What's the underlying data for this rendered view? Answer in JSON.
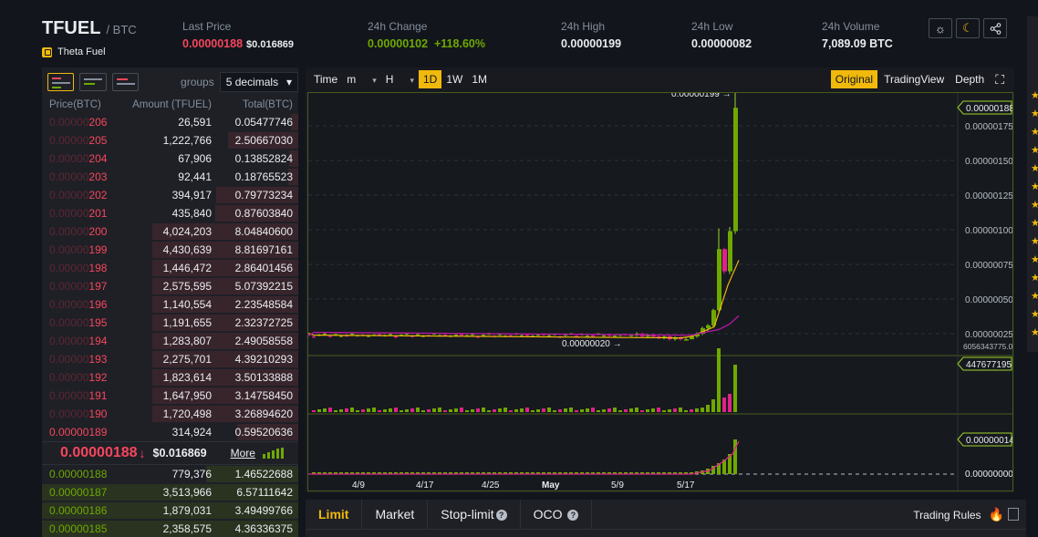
{
  "header": {
    "pair_base": "TFUEL",
    "pair_quote": "/ BTC",
    "coin_name": "Theta Fuel",
    "last_price_label": "Last Price",
    "last_price": "0.00000188",
    "last_price_usd": "$0.016869",
    "change_label": "24h Change",
    "change_value": "0.00000102",
    "change_pct": "+118.60%",
    "high_label": "24h High",
    "high_value": "0.00000199",
    "low_label": "24h Low",
    "low_value": "0.00000082",
    "volume_label": "24h Volume",
    "volume_value": "7,089.09 BTC",
    "icons": [
      "sun-icon",
      "moon-icon",
      "share-icon"
    ]
  },
  "orderbook": {
    "groups_label": "groups",
    "groups_value": "5 decimals",
    "columns": [
      "Price(BTC)",
      "Amount (TFUEL)",
      "Total(BTC)"
    ],
    "asks": [
      {
        "price_dim": "0.00000",
        "price_hi": "206",
        "amount": "26,591",
        "total": "0.05477746",
        "depth": 0.05
      },
      {
        "price_dim": "0.00000",
        "price_hi": "205",
        "amount": "1,222,766",
        "total": "2.50667030",
        "depth": 0.48
      },
      {
        "price_dim": "0.00000",
        "price_hi": "204",
        "amount": "67,906",
        "total": "0.13852824",
        "depth": 0.06
      },
      {
        "price_dim": "0.00000",
        "price_hi": "203",
        "amount": "92,441",
        "total": "0.18765523",
        "depth": 0.07
      },
      {
        "price_dim": "0.00000",
        "price_hi": "202",
        "amount": "394,917",
        "total": "0.79773234",
        "depth": 0.56
      },
      {
        "price_dim": "0.00000",
        "price_hi": "201",
        "amount": "435,840",
        "total": "0.87603840",
        "depth": 0.57
      },
      {
        "price_dim": "0.00000",
        "price_hi": "200",
        "amount": "4,024,203",
        "total": "8.04840600",
        "depth": 1.0
      },
      {
        "price_dim": "0.00000",
        "price_hi": "199",
        "amount": "4,430,639",
        "total": "8.81697161",
        "depth": 1.0
      },
      {
        "price_dim": "0.00000",
        "price_hi": "198",
        "amount": "1,446,472",
        "total": "2.86401456",
        "depth": 1.0
      },
      {
        "price_dim": "0.00000",
        "price_hi": "197",
        "amount": "2,575,595",
        "total": "5.07392215",
        "depth": 1.0
      },
      {
        "price_dim": "0.00000",
        "price_hi": "196",
        "amount": "1,140,554",
        "total": "2.23548584",
        "depth": 1.0
      },
      {
        "price_dim": "0.00000",
        "price_hi": "195",
        "amount": "1,191,655",
        "total": "2.32372725",
        "depth": 1.0
      },
      {
        "price_dim": "0.00000",
        "price_hi": "194",
        "amount": "1,283,807",
        "total": "2.49058558",
        "depth": 1.0
      },
      {
        "price_dim": "0.00000",
        "price_hi": "193",
        "amount": "2,275,701",
        "total": "4.39210293",
        "depth": 1.0
      },
      {
        "price_dim": "0.00000",
        "price_hi": "192",
        "amount": "1,823,614",
        "total": "3.50133888",
        "depth": 1.0
      },
      {
        "price_dim": "0.00000",
        "price_hi": "191",
        "amount": "1,647,950",
        "total": "3.14758450",
        "depth": 1.0
      },
      {
        "price_dim": "0.00000",
        "price_hi": "190",
        "amount": "1,720,498",
        "total": "3.26894620",
        "depth": 1.0
      },
      {
        "price_dim": "",
        "price_hi": "0.00000189",
        "amount": "314,924",
        "total": "0.59520636",
        "depth": 0.42
      }
    ],
    "mid_price": "0.00000188",
    "mid_arrow": "↓",
    "mid_usd": "$0.016869",
    "more_label": "More",
    "bids": [
      {
        "price": "0.00000188",
        "amount": "779,376",
        "total": "1.46522688",
        "depth": 0.36
      },
      {
        "price": "0.00000187",
        "amount": "3,513,966",
        "total": "6.57111642",
        "depth": 1.0
      },
      {
        "price": "0.00000186",
        "amount": "1,879,031",
        "total": "3.49499766",
        "depth": 1.0
      },
      {
        "price": "0.00000185",
        "amount": "2,358,575",
        "total": "4.36336375",
        "depth": 1.0
      }
    ]
  },
  "chart_toolbar": {
    "time_label": "Time",
    "minute_sel": "m",
    "hour_sel": "H",
    "intervals": [
      "1D",
      "1W",
      "1M"
    ],
    "active_interval": "1D",
    "views": [
      "Original",
      "TradingView",
      "Depth"
    ],
    "active_view": "Original"
  },
  "chart_labels": {
    "high_marker": "0.00000199",
    "low_marker": "0.00000020",
    "price_ticks": [
      "0.00000175",
      "0.00000150",
      "0.00000125",
      "0.00000100",
      "0.00000075",
      "0.00000050",
      "0.00000025"
    ],
    "current_price_tag": "0.00000188",
    "bottom_axis_value": "6056343775.00",
    "volume_tag": "447677195",
    "indicator_tag": "0.00000014",
    "indicator_zero": "0.00000000",
    "x_ticks": [
      "4/9",
      "4/17",
      "4/25",
      "May",
      "5/9",
      "5/17"
    ]
  },
  "chart_data": {
    "type": "candlestick",
    "series": [
      {
        "name": "",
        "values": [
          [
            2.4e-07,
            2.6e-07,
            2.3e-07,
            2.5e-07
          ],
          [
            2.5e-07,
            2.6e-07,
            2.2e-07,
            2.3e-07
          ],
          [
            2.3e-07,
            2.5e-07,
            2.2e-07,
            2.4e-07
          ],
          [
            2.4e-07,
            2.5e-07,
            2.2e-07,
            2.3e-07
          ],
          [
            2.3e-07,
            2.4e-07,
            2.1e-07,
            2.2e-07
          ],
          [
            2.2e-07,
            2.4e-07,
            2.1e-07,
            2.3e-07
          ],
          [
            2.3e-07,
            2.4e-07,
            2e-07,
            2.1e-07
          ],
          [
            2.1e-07,
            2.3e-07,
            2e-07,
            2.2e-07
          ],
          [
            2.2e-07,
            2.3e-07,
            2e-07,
            2.1e-07
          ],
          [
            2.1e-07,
            2.2e-07,
            2e-07,
            2.1e-07
          ],
          [
            2.1e-07,
            2.4e-07,
            2.1e-07,
            2.3e-07
          ],
          [
            2.3e-07,
            2.6e-07,
            2.2e-07,
            2.5e-07
          ],
          [
            2.5e-07,
            3e-07,
            2.4e-07,
            2.9e-07
          ],
          [
            2.9e-07,
            3.2e-07,
            2.7e-07,
            3.1e-07
          ],
          [
            3.1e-07,
            4.3e-07,
            3e-07,
            4.2e-07
          ],
          [
            4.2e-07,
            1.01e-06,
            4.1e-07,
            8.6e-07
          ],
          [
            8.6e-07,
            8.7e-07,
            6.8e-07,
            7e-07
          ],
          [
            7e-07,
            1.02e-06,
            6.8e-07,
            9.9e-07
          ],
          [
            9.9e-07,
            1.99e-06,
            9.7e-07,
            1.88e-06
          ]
        ]
      }
    ],
    "ylim": [
      2e-07,
      1.99e-06
    ]
  }
}
